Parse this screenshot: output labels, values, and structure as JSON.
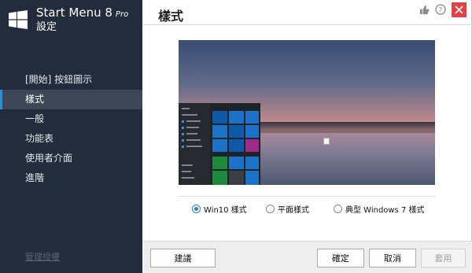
{
  "app": {
    "title": "Start Menu 8",
    "edition": "Pro",
    "subtitle": "設定"
  },
  "sidebar": {
    "items": [
      {
        "label": "[開始] 按鈕圖示",
        "active": false
      },
      {
        "label": "樣式",
        "active": true
      },
      {
        "label": "一般",
        "active": false
      },
      {
        "label": "功能表",
        "active": false
      },
      {
        "label": "使用者介面",
        "active": false
      },
      {
        "label": "進階",
        "active": false
      }
    ],
    "footer_label": "管理授權"
  },
  "main": {
    "title": "樣式",
    "top_icons": [
      "thumbs-up-icon",
      "help-icon",
      "close-icon"
    ]
  },
  "style_options": [
    {
      "label": "Win10 樣式",
      "checked": true
    },
    {
      "label": "平面樣式",
      "checked": false
    },
    {
      "label": "典型 Windows 7 樣式",
      "checked": false
    }
  ],
  "footer": {
    "suggest_label": "建議",
    "ok_label": "確定",
    "cancel_label": "取消",
    "apply_label": "套用",
    "apply_enabled": false
  },
  "colors": {
    "sidebar_bg": "#222c3c",
    "active_item_bg": "#3d4757",
    "accent": "#2d8fd6",
    "close_red": "#e04343",
    "tile_blue": "#1a73c9"
  }
}
